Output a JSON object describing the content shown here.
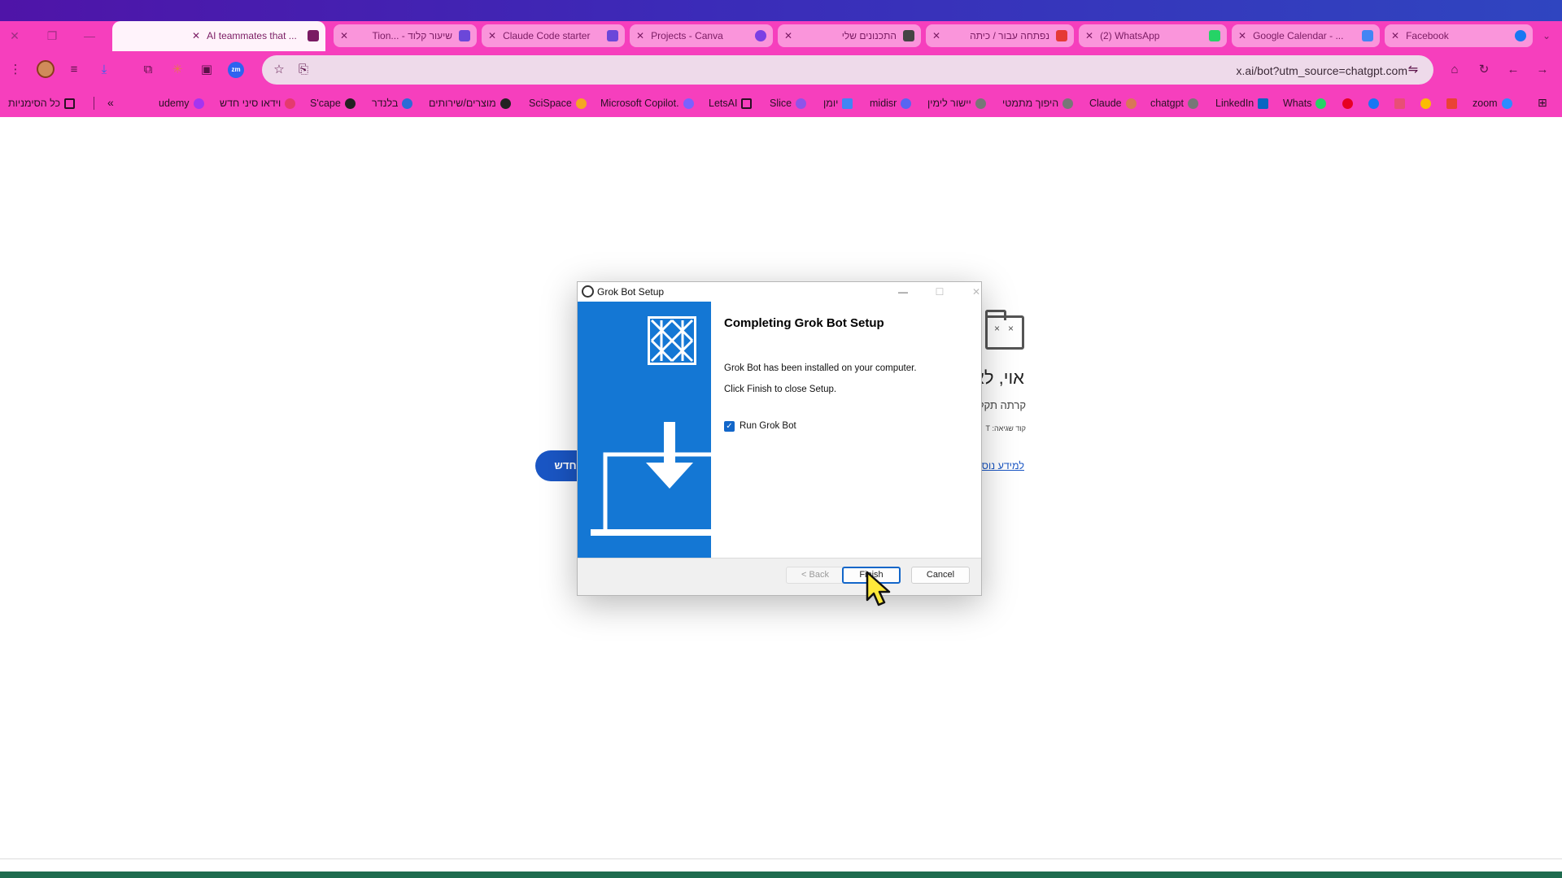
{
  "browser": {
    "tabs": [
      {
        "title": "AI teammates that ..."
      },
      {
        "title": "שיעור קלוד - ...Tion"
      },
      {
        "title": "Claude Code starter"
      },
      {
        "title": "Projects - Canva"
      },
      {
        "title": "התכנונים שלי"
      },
      {
        "title": "נפתחה עבור / כיתה"
      },
      {
        "title": "(2) WhatsApp"
      },
      {
        "title": "Google Calendar - ..."
      },
      {
        "title": "Facebook"
      }
    ],
    "url": "x.ai/bot?utm_source=chatgpt.com",
    "bookmarks": [
      {
        "label": "כל הסימניות",
        "color": "#7a1b63"
      },
      {
        "label": "udemy",
        "color": "#a435f0"
      },
      {
        "label": "וידאו סיני חדש",
        "color": "#e53a6e"
      },
      {
        "label": "S'cape",
        "color": "#222222"
      },
      {
        "label": "בלנדר",
        "color": "#2c6bd6"
      },
      {
        "label": "מוצרים/שירותים",
        "color": "#222222"
      },
      {
        "label": "SciSpace",
        "color": "#f5a623"
      },
      {
        "label": "Microsoft Copilot.",
        "color": "#7b61ff"
      },
      {
        "label": "LetsAI",
        "color": "#7a1b63"
      },
      {
        "label": "Slice",
        "color": "#8e54e9"
      },
      {
        "label": "יומן",
        "color": "#4285f4"
      },
      {
        "label": "midisr",
        "color": "#5865f2"
      },
      {
        "label": "יישור לימין",
        "color": "#777777"
      },
      {
        "label": "היפוך מתמטי",
        "color": "#777777"
      },
      {
        "label": "Claude",
        "color": "#d97757"
      },
      {
        "label": "chatgpt",
        "color": "#777777"
      },
      {
        "label": "LinkedIn",
        "color": "#0a66c2"
      },
      {
        "label": "Whats",
        "color": "#25d366"
      },
      {
        "label": "",
        "color": "#e60023"
      },
      {
        "label": "",
        "color": "#1877f2"
      },
      {
        "label": "",
        "color": "#e94e77"
      },
      {
        "label": "",
        "color": "#fbbc05"
      },
      {
        "label": "",
        "color": "#ea4335"
      },
      {
        "label": "zoom",
        "color": "#2d8cff"
      }
    ]
  },
  "error_page": {
    "title": "אוי, לא",
    "subtitle": "קרתה תקלה",
    "code": "קוד שגיאה: T",
    "link": "למידע נוסף",
    "button": "מחדש"
  },
  "dialog": {
    "title": "Grok Bot Setup",
    "heading": "Completing Grok Bot Setup",
    "line1": "Grok Bot has been installed on your computer.",
    "line2": "Click Finish to close Setup.",
    "checkbox_label": "Run Grok Bot",
    "checkbox_checked": true,
    "back": "< Back",
    "finish": "Finish",
    "cancel": "Cancel",
    "accent": "#1477d4"
  }
}
